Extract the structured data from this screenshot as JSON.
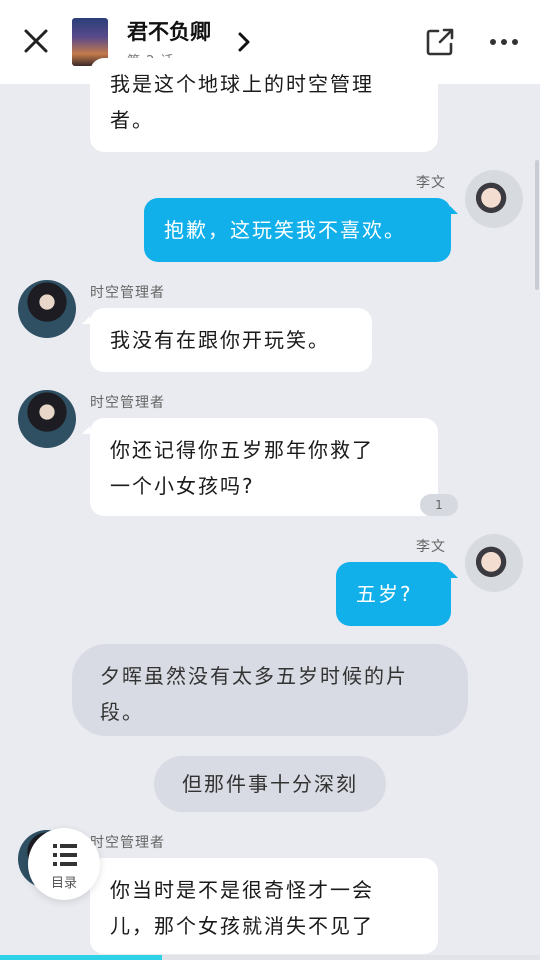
{
  "header": {
    "title": "君不负卿",
    "episode": "第 2 话"
  },
  "messages": [
    {
      "id": "m0",
      "type": "left",
      "text_line1": "我是这个地球上的时空管理",
      "text_line2": "者。"
    },
    {
      "id": "m1",
      "type": "right",
      "speaker": "李文",
      "text": "抱歉，这玩笑我不喜欢。"
    },
    {
      "id": "m2",
      "type": "left",
      "speaker": "时空管理者",
      "text": "我没有在跟你开玩笑。"
    },
    {
      "id": "m3",
      "type": "left",
      "speaker": "时空管理者",
      "text_line1": "你还记得你五岁那年你救了",
      "text_line2": "一个小女孩吗?",
      "comment_count": "1"
    },
    {
      "id": "m4",
      "type": "right",
      "speaker": "李文",
      "text": "五岁?"
    },
    {
      "id": "m5",
      "type": "narration",
      "text_line1": "夕晖虽然没有太多五岁时候的片",
      "text_line2": "段。"
    },
    {
      "id": "m6",
      "type": "narration",
      "text": "但那件事十分深刻"
    },
    {
      "id": "m7",
      "type": "left",
      "speaker": "时空管理者",
      "text_line1": "你当时是不是很奇怪才一会",
      "text_line2": "儿，那个女孩就消失不见了"
    }
  ],
  "toc": {
    "label": "目录"
  },
  "progress": {
    "fraction": 0.3
  },
  "colors": {
    "accent": "#12b0eb",
    "progress": "#2fd1e6",
    "background": "#e9ebf0"
  },
  "icons": [
    "close-icon",
    "chevron-right-icon",
    "share-icon",
    "more-icon",
    "list-icon"
  ]
}
